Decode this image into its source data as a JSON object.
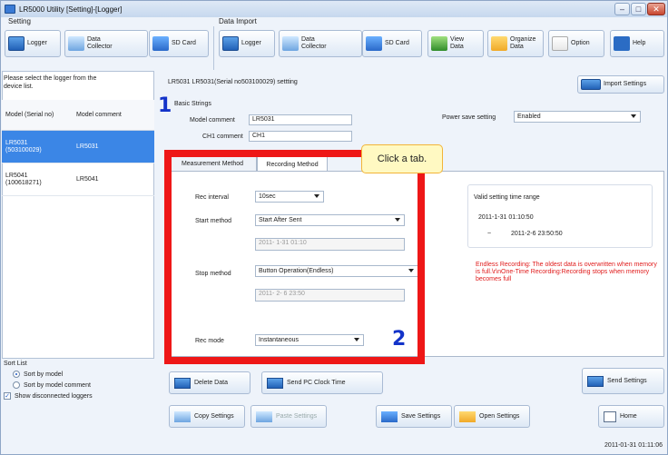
{
  "window": {
    "title": "LR5000 Utility [Setting]-[Logger]"
  },
  "groups": {
    "setting": "Setting",
    "data_import": "Data Import"
  },
  "toolbar": {
    "logger": "Logger",
    "data_collector": "Data Collector",
    "sd_card": "SD Card",
    "import_logger": "Logger",
    "import_data_collector": "Data Collector",
    "import_sd_card": "SD Card",
    "view_data": "View Data",
    "organize_data": "Organize Data",
    "option": "Option",
    "help": "Help"
  },
  "left": {
    "hint": "Please select the logger from the device list.",
    "head_model": "Model (Serial no)",
    "head_comment": "Model comment",
    "rows": [
      {
        "model": "LR5031",
        "serial": "(503100029)",
        "comment": "LR5031"
      },
      {
        "model": "LR5041",
        "serial": "(100618271)",
        "comment": "LR5041"
      }
    ]
  },
  "badges": {
    "b1": "1",
    "b2": "2"
  },
  "main": {
    "header": "LR5031 LR5031(Serial no503100029) settting",
    "basic": "Basic Strings",
    "model_comment_label": "Model comment",
    "model_comment_value": "LR5031",
    "ch1_label": "CH1 comment",
    "ch1_value": "CH1",
    "power_label": "Power save setting",
    "power_value": "Enabled",
    "import_settings": "Import Settings"
  },
  "tabs": {
    "measurement": "Measurement Method",
    "recording": "Recording Method"
  },
  "callout": "Click a tab.",
  "recording": {
    "rec_interval_label": "Rec interval",
    "rec_interval_value": "10sec",
    "start_method_label": "Start method",
    "start_method_value": "Start After Sent",
    "start_time": "2011- 1-31 01:10",
    "stop_method_label": "Stop method",
    "stop_method_value": "Button Operation(Endless)",
    "stop_time": "2011- 2- 6 23:50",
    "rec_mode_label": "Rec mode",
    "rec_mode_value": "Instantaneous"
  },
  "valid": {
    "title": "Valid setting time range",
    "from": "2011-1-31 01:10:50",
    "tilde": "~",
    "to": "2011-2-6 23:50:50"
  },
  "note": "Endless Recording: The oldest data is overwritten when memory is full.\\r\\nOne-Time Recording:Recording stops when memory becomes full",
  "buttons": {
    "delete": "Delete Data",
    "send_clock": "Send PC Clock Time",
    "send_settings": "Send Settings",
    "copy": "Copy Settings",
    "paste": "Paste Settings",
    "save": "Save Settings",
    "open": "Open Settings",
    "home": "Home"
  },
  "sort": {
    "title": "Sort List",
    "by_model": "Sort by model",
    "by_comment": "Sort by model comment",
    "show_disconnected": "Show disconnected loggers"
  },
  "status": {
    "time": "2011-01-31 01:11:06"
  }
}
